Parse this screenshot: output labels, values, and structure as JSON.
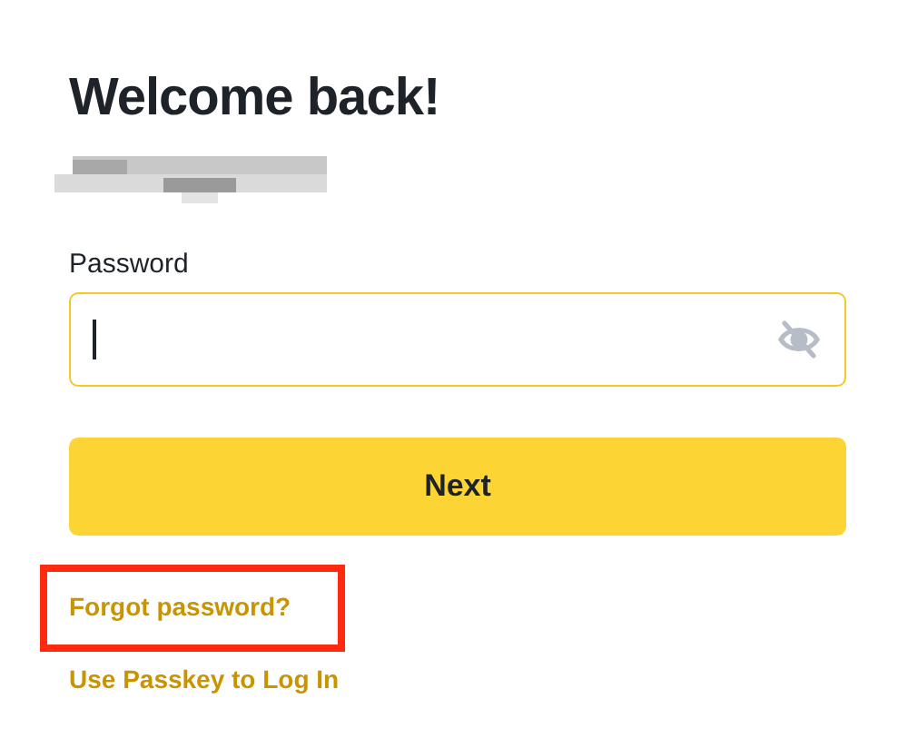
{
  "title": "Welcome back!",
  "password": {
    "label": "Password",
    "focused": true,
    "visibility_hidden": true
  },
  "next_button": "Next",
  "links": [
    {
      "text": "Forgot password?",
      "highlighted": true
    },
    {
      "text": "Use Passkey to Log In",
      "highlighted": false
    }
  ]
}
